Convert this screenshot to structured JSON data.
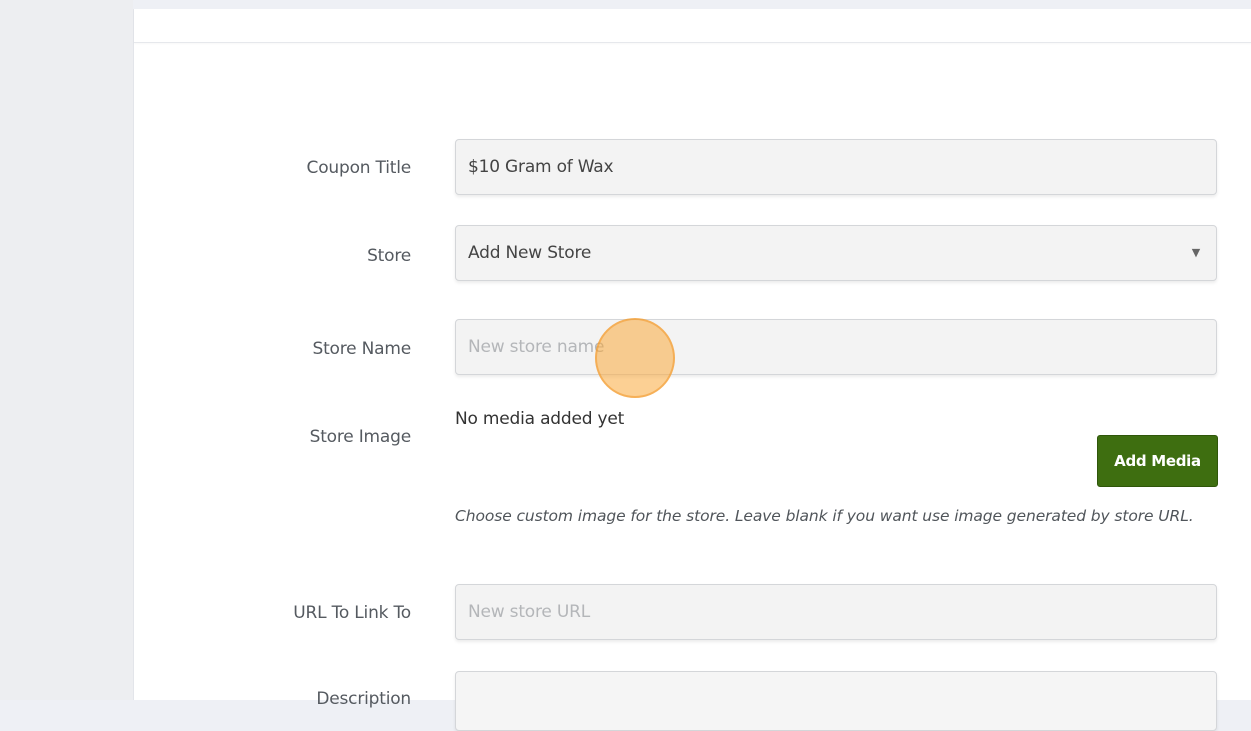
{
  "form": {
    "coupon_title": {
      "label": "Coupon Title",
      "value": "$10 Gram of Wax"
    },
    "store": {
      "label": "Store",
      "selected": "Add New Store",
      "caret": "▼"
    },
    "store_name": {
      "label": "Store Name",
      "placeholder": "New store name"
    },
    "store_image": {
      "label": "Store Image",
      "status": "No media added yet",
      "button_label": "Add Media",
      "help_text": "Choose custom image for the store. Leave blank if you want use image generated by store URL."
    },
    "url": {
      "label": "URL To Link To",
      "placeholder": "New store URL"
    },
    "description": {
      "label": "Description",
      "value": ""
    }
  },
  "colors": {
    "accent_button": "#3e6e10",
    "cursor_highlight": "#faaa3c"
  }
}
